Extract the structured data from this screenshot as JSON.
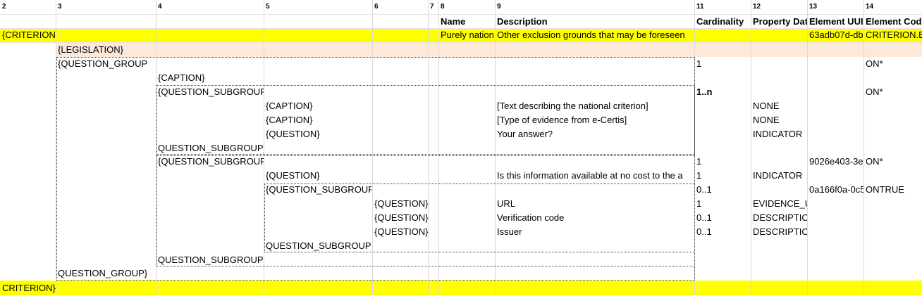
{
  "colnums": [
    "2",
    "3",
    "4",
    "5",
    "6",
    "7",
    "8",
    "9",
    "11",
    "12",
    "13",
    "14"
  ],
  "headers": {
    "name": "Name",
    "description": "Description",
    "cardinality": "Cardinality",
    "property_data": "Property Dat",
    "element_uuid": "Element UUI",
    "element_code": "Element Cod"
  },
  "criterion": {
    "open": "{CRITERION",
    "name": "Purely nation",
    "description": "Other exclusion grounds that may be foreseen",
    "uuid": "63adb07d-db",
    "code": "CRITERION.E",
    "close": "CRITERION}"
  },
  "legislation": "{LEGISLATION}",
  "question_group": {
    "open": "{QUESTION_GROUP",
    "cardinality": "1",
    "code": "ON*",
    "close": "QUESTION_GROUP}"
  },
  "caption_top": "{CAPTION}",
  "subgroup1": {
    "open": "{QUESTION_SUBGROUP",
    "cardinality": "1..n",
    "code": "ON*",
    "rows": [
      {
        "tag": "{CAPTION}",
        "description": "[Text describing the national criterion]",
        "prop": "NONE"
      },
      {
        "tag": "{CAPTION}",
        "description": "[Type of evidence from e-Certis]",
        "prop": "NONE"
      },
      {
        "tag": "{QUESTION}",
        "description": "Your answer?",
        "prop": "INDICATOR"
      }
    ],
    "close": "QUESTION_SUBGROUP}"
  },
  "subgroup2": {
    "open": "{QUESTION_SUBGROUP",
    "cardinality": "1",
    "uuid": "9026e403-3e",
    "code": "ON*",
    "question": {
      "tag": "{QUESTION}",
      "description": "Is this information available at no cost to the a",
      "cardinality": "1",
      "prop": "INDICATOR"
    },
    "close": "QUESTION_SUBGROUP}"
  },
  "subgroup3": {
    "open": "{QUESTION_SUBGROUP",
    "cardinality": "0..1",
    "uuid": "0a166f0a-0c5",
    "code": "ONTRUE",
    "rows": [
      {
        "tag": "{QUESTION}",
        "description": "URL",
        "cardinality": "1",
        "prop": "EVIDENCE_U"
      },
      {
        "tag": "{QUESTION}",
        "description": "Verification code",
        "cardinality": "0..1",
        "prop": "DESCRIPTION"
      },
      {
        "tag": "{QUESTION}",
        "description": "Issuer",
        "cardinality": "0..1",
        "prop": "DESCRIPTION"
      }
    ],
    "close": "QUESTION_SUBGROUP}"
  },
  "colors": {
    "criterion_fill": "#ffff00",
    "legislation_fill": "#fde9d9",
    "grid": "#dadada"
  }
}
